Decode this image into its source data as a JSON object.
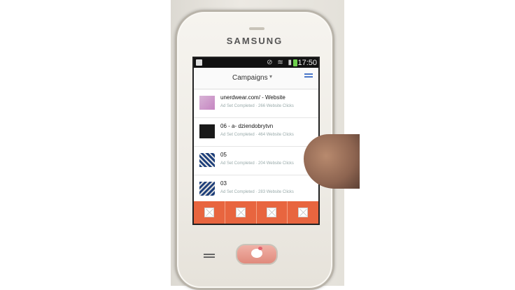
{
  "device": {
    "brand": "SAMSUNG"
  },
  "status_bar": {
    "time": "17:50",
    "icons": [
      "mute-icon",
      "wifi-icon",
      "signal-icon",
      "battery-icon"
    ]
  },
  "app_bar": {
    "title": "Campaigns",
    "dropdown_icon": "chevron-down-icon",
    "filter_icon": "filter-icon",
    "accent": "#4a76c8"
  },
  "campaigns": [
    {
      "title": "unerdwear.com/ - Website",
      "subtitle": "Ad Set Completed · 266 Website Clicks"
    },
    {
      "title": "06 - a- dziendobrytvn",
      "subtitle": "Ad Set Completed · 464 Website Clicks"
    },
    {
      "title": "05",
      "subtitle": "Ad Set Completed · 204 Website Clicks"
    },
    {
      "title": "03",
      "subtitle": "Ad Set Completed · 283 Website Clicks"
    }
  ],
  "action_bar": {
    "color": "#e8653f",
    "buttons": [
      "x-icon",
      "x-icon",
      "x-icon",
      "x-icon"
    ]
  }
}
